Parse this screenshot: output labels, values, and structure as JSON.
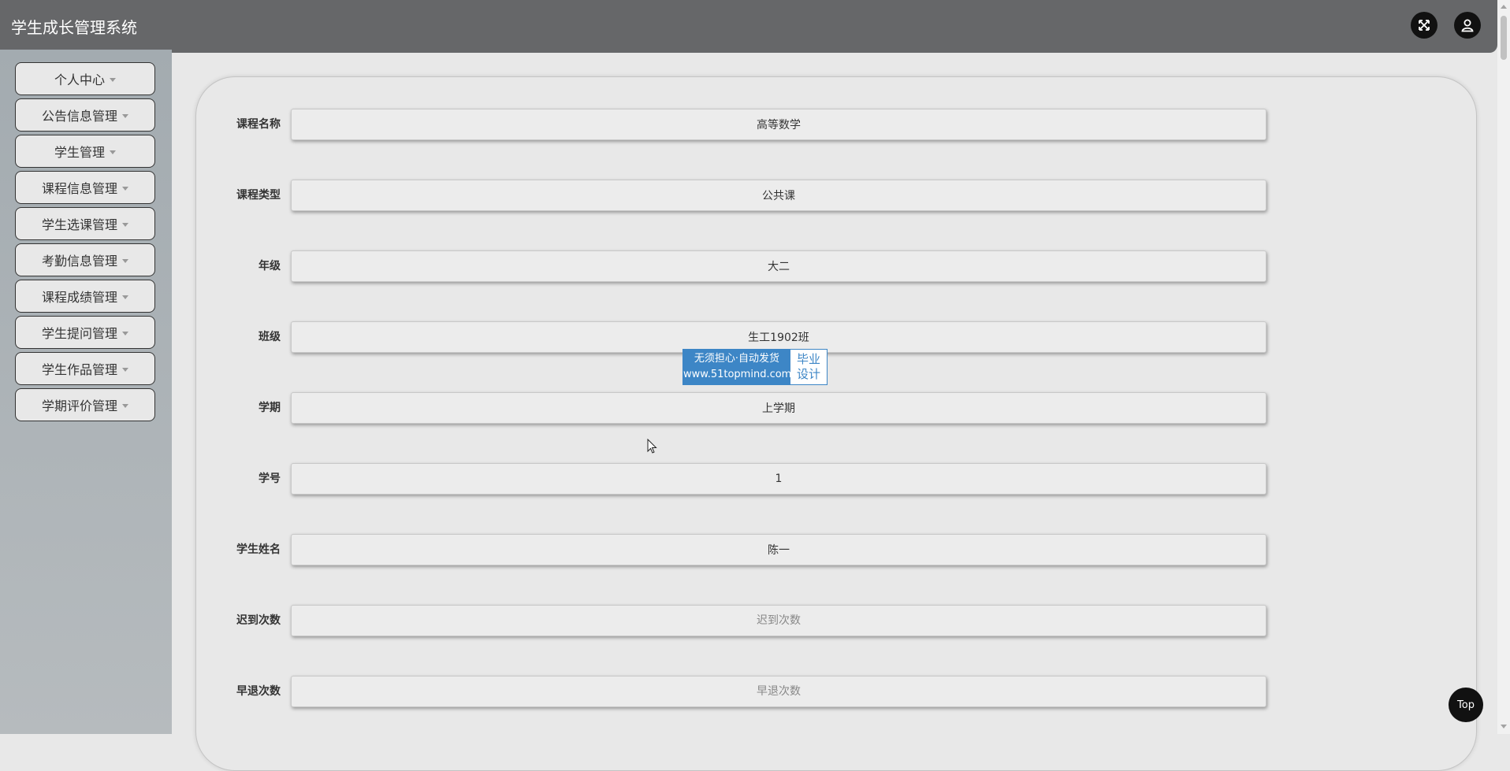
{
  "header": {
    "title": "学生成长管理系统",
    "fullscreen_icon": "expand-arrows-icon",
    "user_icon": "user-icon"
  },
  "sidebar": {
    "items": [
      {
        "label": "个人中心"
      },
      {
        "label": "公告信息管理"
      },
      {
        "label": "学生管理"
      },
      {
        "label": "课程信息管理"
      },
      {
        "label": "学生选课管理"
      },
      {
        "label": "考勤信息管理"
      },
      {
        "label": "课程成绩管理"
      },
      {
        "label": "学生提问管理"
      },
      {
        "label": "学生作品管理"
      },
      {
        "label": "学期评价管理"
      }
    ]
  },
  "form": {
    "fields": [
      {
        "label": "课程名称",
        "value": "高等数学",
        "placeholder": ""
      },
      {
        "label": "课程类型",
        "value": "公共课",
        "placeholder": ""
      },
      {
        "label": "年级",
        "value": "大二",
        "placeholder": ""
      },
      {
        "label": "班级",
        "value": "生工1902班",
        "placeholder": ""
      },
      {
        "label": "学期",
        "value": "上学期",
        "placeholder": ""
      },
      {
        "label": "学号",
        "value": "1",
        "placeholder": ""
      },
      {
        "label": "学生姓名",
        "value": "陈一",
        "placeholder": ""
      },
      {
        "label": "迟到次数",
        "value": "",
        "placeholder": "迟到次数"
      },
      {
        "label": "早退次数",
        "value": "",
        "placeholder": "早退次数"
      }
    ]
  },
  "watermark": {
    "line1": "无须担心·自动发货",
    "line2": "www.51topmind.com",
    "side_line1": "毕业",
    "side_line2": "设计"
  },
  "back_to_top": {
    "label": "Top"
  },
  "colors": {
    "header_bg": "#666769",
    "sidebar_bg": "#a3abb0",
    "accent_black": "#111111",
    "watermark_blue": "#3d86c6"
  }
}
